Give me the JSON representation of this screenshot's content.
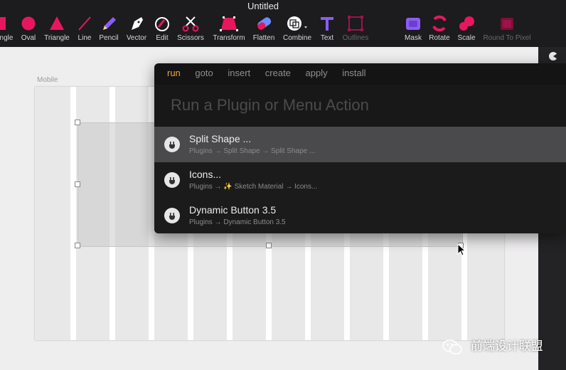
{
  "window": {
    "title": "Untitled"
  },
  "toolbar": {
    "tools": [
      {
        "name": "rectangle-tool",
        "label": "ngle",
        "icon": "rectangle-icon",
        "color": "#e8175d",
        "disabled": false
      },
      {
        "name": "oval-tool",
        "label": "Oval",
        "icon": "oval-icon",
        "color": "#e8175d",
        "disabled": false
      },
      {
        "name": "triangle-tool",
        "label": "Triangle",
        "icon": "triangle-icon",
        "color": "#e8175d",
        "disabled": false
      },
      {
        "name": "line-tool",
        "label": "Line",
        "icon": "line-icon",
        "color": "#e8175d",
        "disabled": false
      },
      {
        "name": "pencil-tool",
        "label": "Pencil",
        "icon": "pencil-icon",
        "color": "#8b5cf6",
        "disabled": false
      },
      {
        "name": "vector-tool",
        "label": "Vector",
        "icon": "vector-pen-icon",
        "color": "#ffffff",
        "disabled": false
      },
      {
        "name": "edit-tool",
        "label": "Edit",
        "icon": "edit-icon",
        "color": "#e8175d",
        "disabled": false
      },
      {
        "name": "scissors-tool",
        "label": "Scissors",
        "icon": "scissors-icon",
        "color": "#e8175d",
        "disabled": false
      },
      {
        "name": "transform-tool",
        "label": "Transform",
        "icon": "transform-icon",
        "color": "#e8175d",
        "disabled": false
      },
      {
        "name": "flatten-tool",
        "label": "Flatten",
        "icon": "flatten-icon",
        "color": "#6b8cff",
        "disabled": false
      },
      {
        "name": "combine-tool",
        "label": "Combine",
        "icon": "combine-icon",
        "color": "#ffffff",
        "disabled": false
      },
      {
        "name": "text-tool",
        "label": "Text",
        "icon": "text-icon",
        "color": "#8b5cf6",
        "disabled": false
      },
      {
        "name": "outlines-tool",
        "label": "Outlines",
        "icon": "outlines-icon",
        "color": "#e8175d",
        "disabled": true
      },
      {
        "name": "mask-tool",
        "label": "Mask",
        "icon": "mask-icon",
        "color": "#8b5cf6",
        "disabled": false
      },
      {
        "name": "rotate-tool",
        "label": "Rotate",
        "icon": "rotate-icon",
        "color": "#e8175d",
        "disabled": false
      },
      {
        "name": "scale-tool",
        "label": "Scale",
        "icon": "scale-icon",
        "color": "#e8175d",
        "disabled": false
      },
      {
        "name": "round-to-pixel-tool",
        "label": "Round To Pixel",
        "icon": "round-to-pixel-icon",
        "color": "#e8175d",
        "disabled": true
      }
    ]
  },
  "artboard": {
    "label": "Mobile"
  },
  "runner": {
    "tabs": [
      "run",
      "goto",
      "insert",
      "create",
      "apply",
      "install"
    ],
    "active_tab": "run",
    "search_placeholder": "Run a Plugin or Menu Action",
    "results": [
      {
        "title": "Split Shape ...",
        "path": "Plugins → Split Shape → Split Shape ...",
        "selected": true
      },
      {
        "title": "Icons...",
        "path": "Plugins → ✨  Sketch Material → Icons...",
        "selected": false
      },
      {
        "title": "Dynamic Button 3.5",
        "path": "Plugins → Dynamic Button 3.5",
        "selected": false
      }
    ]
  },
  "watermark": {
    "text": "前端设计联盟",
    "icon": "wechat-icon"
  }
}
